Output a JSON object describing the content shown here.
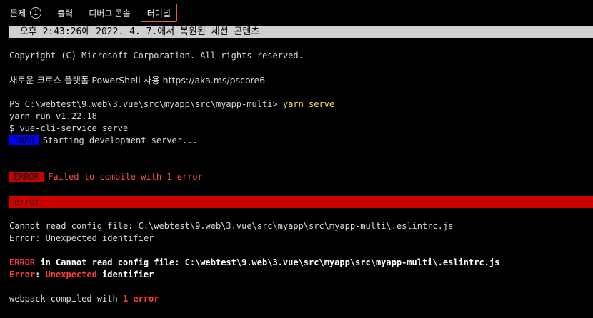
{
  "tabs": [
    {
      "label": "문제",
      "badge": "1"
    },
    {
      "label": "출력"
    },
    {
      "label": "디버그 콘솔"
    },
    {
      "label": "터미널"
    }
  ],
  "restored_banner": " 오후 2:43:26에 2022. 4. 7.에서 복원된 세션 콘텐츠",
  "terminal": {
    "copyright": "Copyright (C) Microsoft Corporation. All rights reserved.",
    "pwsh_note": "새로운 크로스 플랫폼 PowerShell 사용 https://aka.ms/pscore6",
    "prompt": "PS C:\\webtest\\9.web\\3.vue\\src\\myapp\\src\\myapp-multi>",
    "command": "yarn serve",
    "yarn_run": "yarn run v1.22.18",
    "vue_cli": "$ vue-cli-service serve",
    "info_tag": "INFO",
    "info_text": "Starting development server...",
    "error_tag": "ERROR",
    "error_text": "Failed to compile with 1 error",
    "error_bar": "error",
    "cannot_read": "Cannot read config file: C:\\webtest\\9.web\\3.vue\\src\\myapp\\src\\myapp-multi\\.eslintrc.js",
    "unexpected": "Error: Unexpected identifier",
    "err2_word": "ERROR",
    "err2_in": " in Cannot read config file: C:\\webtest\\9.web\\3.vue\\src\\myapp\\src\\myapp-multi\\.eslintrc.js",
    "err3_word": "Error",
    "err3_sep": ": ",
    "err3_unexp": "Unexpected",
    "err3_ident": " identifier",
    "webpack_prefix": "webpack compiled with ",
    "webpack_err": "1 error"
  }
}
